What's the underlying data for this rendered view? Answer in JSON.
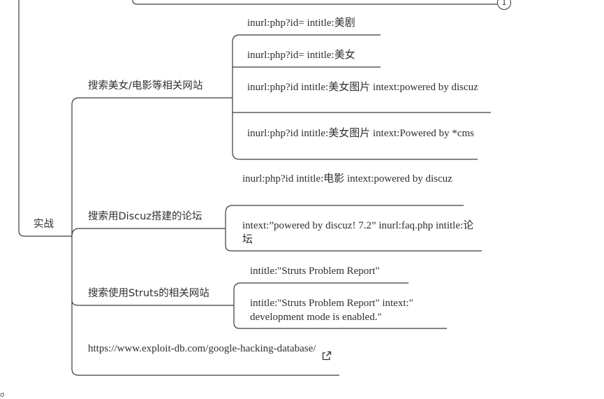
{
  "root": {
    "label": "实战"
  },
  "collapse_badge": "1",
  "branches": [
    {
      "label": "搜索美女/电影等相关网站",
      "children": [
        "inurl:php?id= intitle:美剧",
        "inurl:php?id= intitle:美女",
        "inurl:php?id  intitle:美女图片 intext:powered by discuz",
        "inurl:php?id  intitle:美女图片 intext:Powered by *cms"
      ]
    },
    {
      "label": "搜索用Discuz搭建的论坛",
      "children": [
        "inurl:php?id  intitle:电影 intext:powered by discuz",
        "intext:”powered by discuz!  7.2”   inurl:faq.php intitle:论坛"
      ]
    },
    {
      "label": "搜索使用Struts的相关网站",
      "children": [
        "intitle:\"Struts Problem Report\"",
        "intitle:\"Struts Problem Report\" intext:\" development mode is enabled.\""
      ]
    },
    {
      "label": "https://www.exploit-db.com/google-hacking-database/"
    }
  ],
  "link_icon": "external-link-icon",
  "stray_glyph": "σ"
}
